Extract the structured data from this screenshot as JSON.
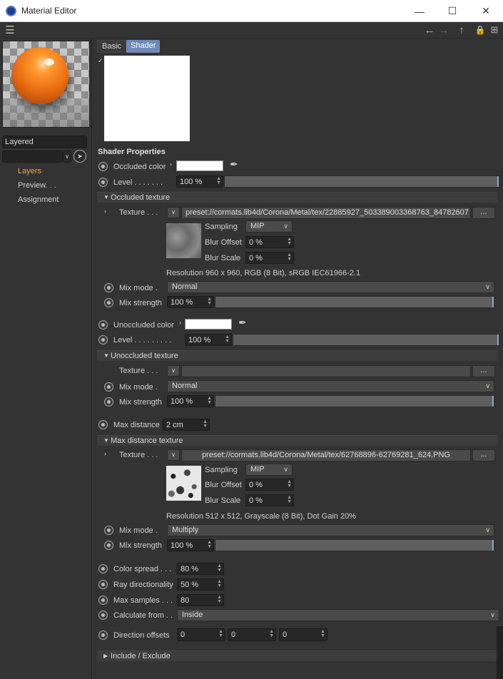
{
  "window": {
    "title": "Material Editor"
  },
  "left": {
    "material_name": "Layered",
    "nav": [
      "Layers",
      "Preview. . .",
      "Assignment"
    ]
  },
  "tabs": [
    "Basic",
    "Shader"
  ],
  "shader": {
    "section_title": "Shader Properties",
    "occluded_color_label": "Occluded color",
    "level_label": "Level . . . . . . .",
    "level_value": "100 %",
    "occluded_texture": {
      "title": "Occluded texture",
      "texture_label": "Texture . . .",
      "path": "preset://cormats.lib4d/Corona/Metal/tex/22885927_503389003368763_84782607",
      "sampling_label": "Sampling",
      "sampling_value": "MIP",
      "blur_offset_label": "Blur Offset",
      "blur_offset_value": "0 %",
      "blur_scale_label": "Blur Scale",
      "blur_scale_value": "0 %",
      "resolution": "Resolution 960 x 960, RGB (8 Bit), sRGB IEC61966-2.1",
      "mix_mode_label": "Mix mode .",
      "mix_mode_value": "Normal",
      "mix_strength_label": "Mix strength",
      "mix_strength_value": "100 %"
    },
    "unoccluded_color_label": "Unoccluded color",
    "level2_label": "Level . . . . . . . . .",
    "level2_value": "100 %",
    "unoccluded_texture": {
      "title": "Unoccluded texture",
      "texture_label": "Texture . . .",
      "path": "",
      "mix_mode_label": "Mix mode .",
      "mix_mode_value": "Normal",
      "mix_strength_label": "Mix strength",
      "mix_strength_value": "100 %"
    },
    "max_distance_label": "Max distance",
    "max_distance_value": "2 cm",
    "max_distance_texture": {
      "title": "Max distance texture",
      "texture_label": "Texture . . .",
      "path": "preset://cormats.lib4d/Corona/Metal/tex/62768896-62769281_624.PNG",
      "sampling_label": "Sampling",
      "sampling_value": "MIP",
      "blur_offset_label": "Blur Offset",
      "blur_offset_value": "0 %",
      "blur_scale_label": "Blur Scale",
      "blur_scale_value": "0 %",
      "resolution": "Resolution 512 x 512, Grayscale (8 Bit), Dot Gain 20%",
      "mix_mode_label": "Mix mode .",
      "mix_mode_value": "Multiply",
      "mix_strength_label": "Mix strength",
      "mix_strength_value": "100 %"
    },
    "color_spread_label": "Color spread . . .",
    "color_spread_value": "80 %",
    "ray_dir_label": "Ray directionality",
    "ray_dir_value": "50 %",
    "max_samples_label": "Max samples . . .",
    "max_samples_value": "80",
    "calc_from_label": "Calculate from . .",
    "calc_from_value": "Inside",
    "dir_offsets_label": "Direction offsets",
    "dir_offsets_values": [
      "0",
      "0",
      "0"
    ],
    "include_exclude": "Include / Exclude"
  },
  "ellipsis": "...",
  "colors": {
    "accent": "#e8a94a",
    "tab_active": "#6f89b8",
    "slider_end": "#8aa6d8"
  }
}
